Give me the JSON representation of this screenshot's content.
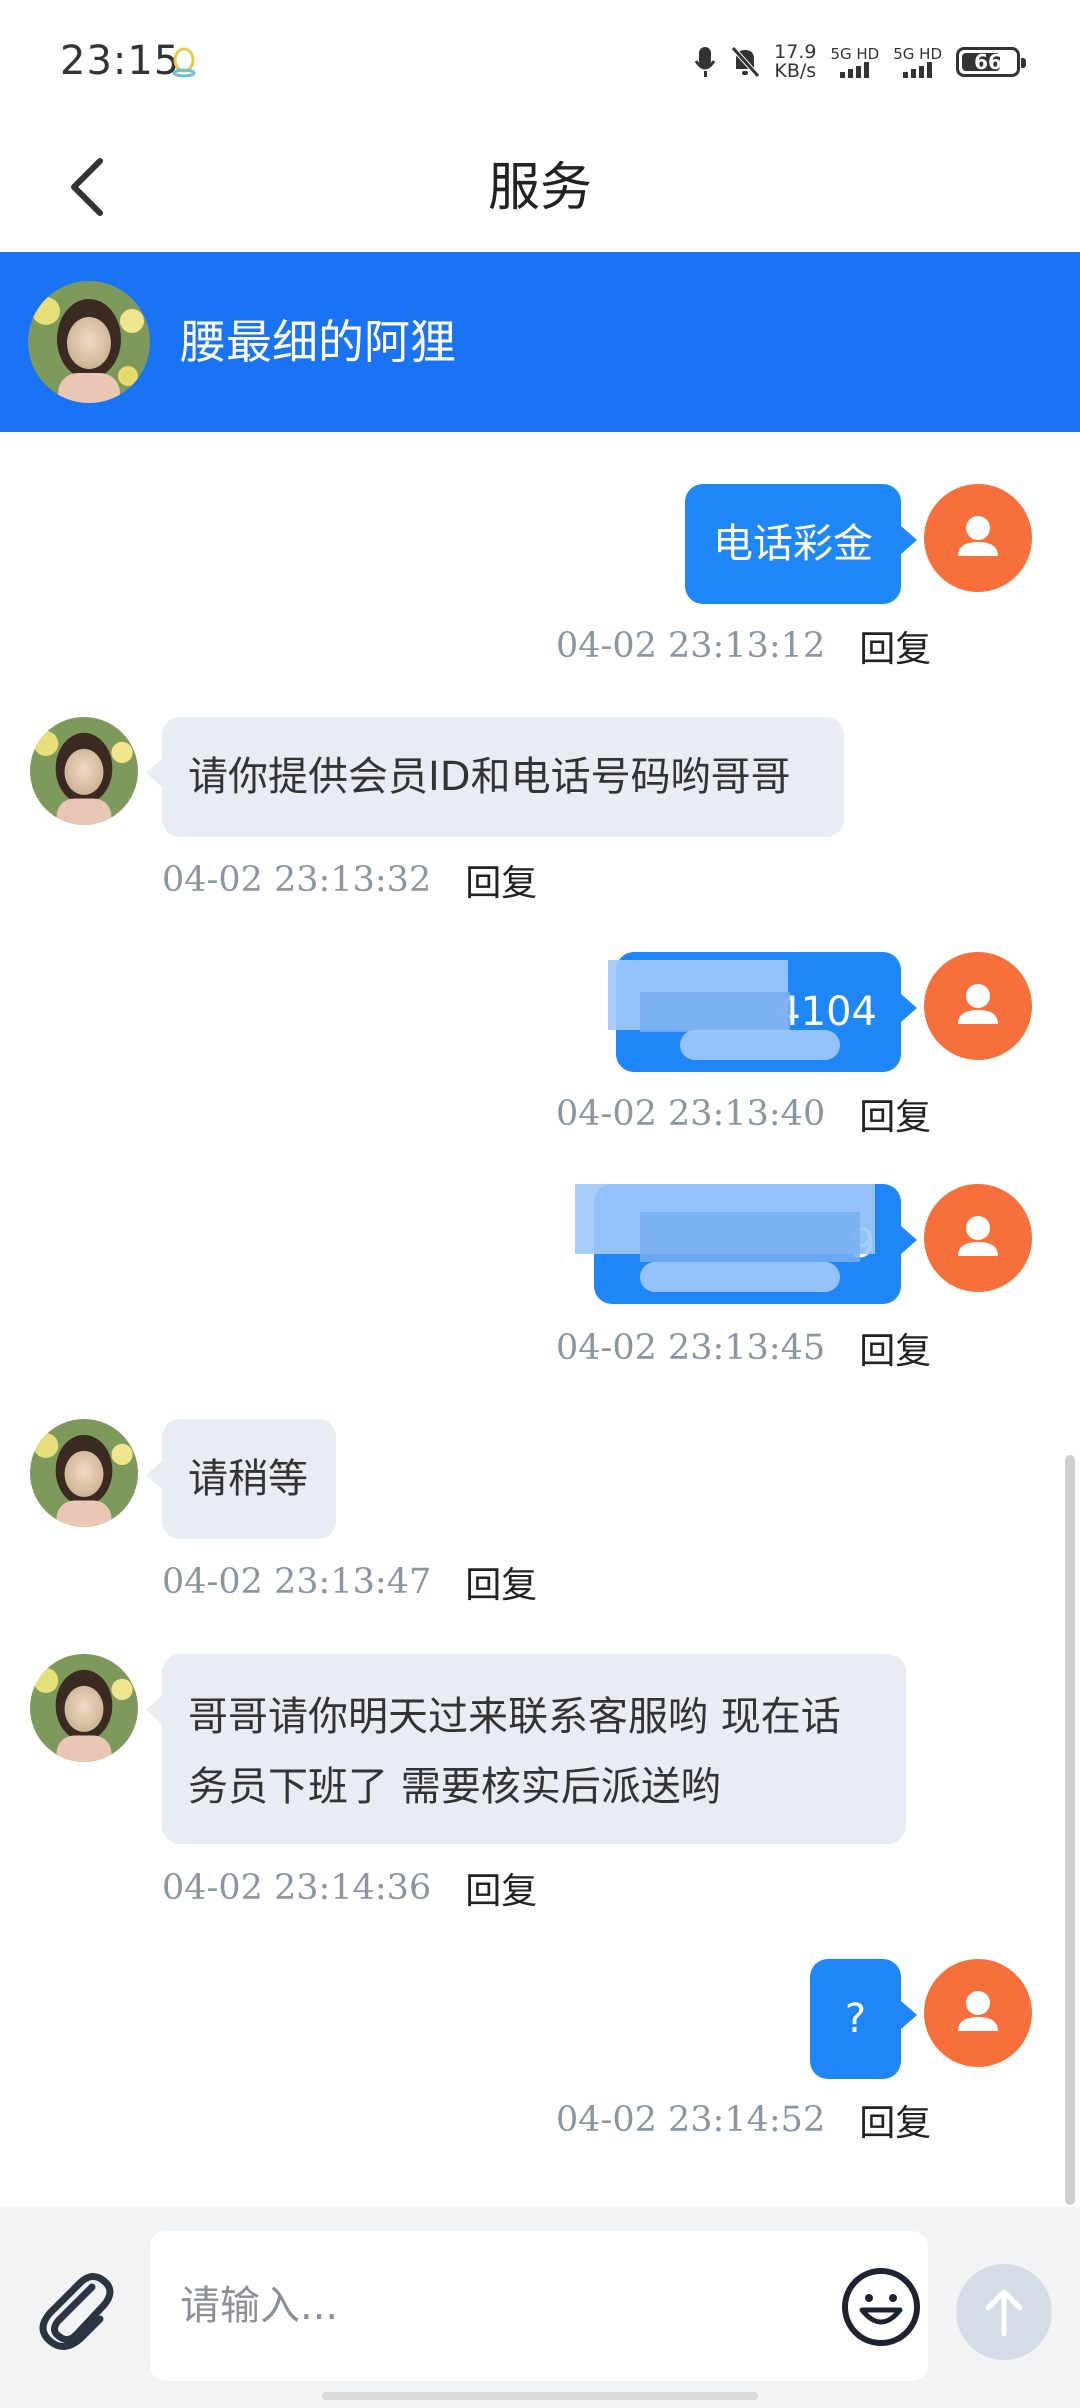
{
  "status_bar": {
    "time": "23:15",
    "net_speed_value": "17.9",
    "net_speed_unit": "KB/s",
    "sim1_label": "5G HD",
    "sim2_label": "5G HD",
    "battery": "66"
  },
  "header": {
    "title": "服务",
    "back_icon": "chevron-left-icon"
  },
  "agent": {
    "name": "腰最细的阿狸"
  },
  "messages": [
    {
      "side": "out",
      "text": "电话彩金",
      "time": "04-02 23:13:12",
      "reply": "回复"
    },
    {
      "side": "in",
      "text": "请你提供会员ID和电话号码哟哥哥",
      "time": "04-02 23:13:32",
      "reply": "回复"
    },
    {
      "side": "out",
      "text": "4104",
      "time": "04-02 23:13:40",
      "reply": "回复"
    },
    {
      "side": "out",
      "text": "9",
      "time": "04-02 23:13:45",
      "reply": "回复"
    },
    {
      "side": "in",
      "text": "请稍等",
      "time": "04-02 23:13:47",
      "reply": "回复"
    },
    {
      "side": "in",
      "text_line1": "哥哥请你明天过来联系客服哟 现在话",
      "text_line2": "务员下班了 需要核实后派送哟",
      "time": "04-02 23:14:36",
      "reply": "回复"
    },
    {
      "side": "out",
      "text": "?",
      "time": "04-02 23:14:52",
      "reply": "回复"
    }
  ],
  "composer": {
    "placeholder": "请输入...",
    "attach_icon": "paperclip-icon",
    "emoji_icon": "smiley-icon",
    "send_icon": "arrow-up-icon"
  },
  "colors": {
    "header_blue": "#1a73f5",
    "outgoing_bubble": "#1f86f7",
    "incoming_bubble": "#e8ecf3",
    "user_avatar": "#f76f3a"
  }
}
